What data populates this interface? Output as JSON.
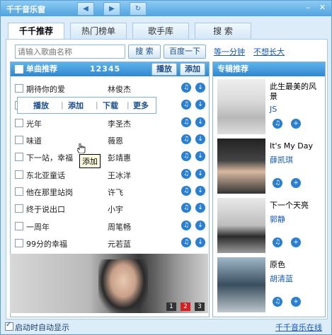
{
  "app": {
    "title": "千千音乐窗"
  },
  "tabs": [
    {
      "label": "千千推荐"
    },
    {
      "label": "热门榜单"
    },
    {
      "label": "歌手库"
    },
    {
      "label": "搜  索"
    }
  ],
  "search": {
    "placeholder": "请输入歌曲名称",
    "search_button": "搜 索",
    "baidu_button": "百度一下",
    "links": [
      "等一分钟",
      "不想长大"
    ]
  },
  "singles": {
    "header_title": "单曲推荐",
    "pages": "12345",
    "play_button": "播放",
    "add_button": "添加",
    "songs": [
      {
        "title": "期待你的爱",
        "artist": "林俊杰"
      },
      {
        "title": "",
        "artist": ""
      },
      {
        "title": "光年",
        "artist": "李圣杰"
      },
      {
        "title": "味道",
        "artist": "薇恩"
      },
      {
        "title": "下一站，幸福",
        "artist": "彭靖惠"
      },
      {
        "title": "东北亚童话",
        "artist": "王冰洋"
      },
      {
        "title": "他在那里站岗",
        "artist": "许飞"
      },
      {
        "title": "终于说出口",
        "artist": "小宇"
      },
      {
        "title": "一周年",
        "artist": "周笔畅"
      },
      {
        "title": "99分的幸福",
        "artist": "元若蓝"
      }
    ],
    "context_menu": [
      "播放",
      "添加",
      "下载",
      "更多"
    ],
    "tooltip": "添加",
    "banner_pages": [
      "1",
      "2",
      "3"
    ]
  },
  "albums": {
    "header_title": "专辑推荐",
    "items": [
      {
        "title": "此生最美的风景",
        "artist": "JS"
      },
      {
        "title": "It's My Day",
        "artist": "薛凯琪"
      },
      {
        "title": "下一个天亮",
        "artist": "郭静"
      },
      {
        "title": "原色",
        "artist": "胡清蓝"
      }
    ]
  },
  "footer": {
    "autostart_label": "启动时自动显示",
    "online_link": "千千音乐在线"
  }
}
